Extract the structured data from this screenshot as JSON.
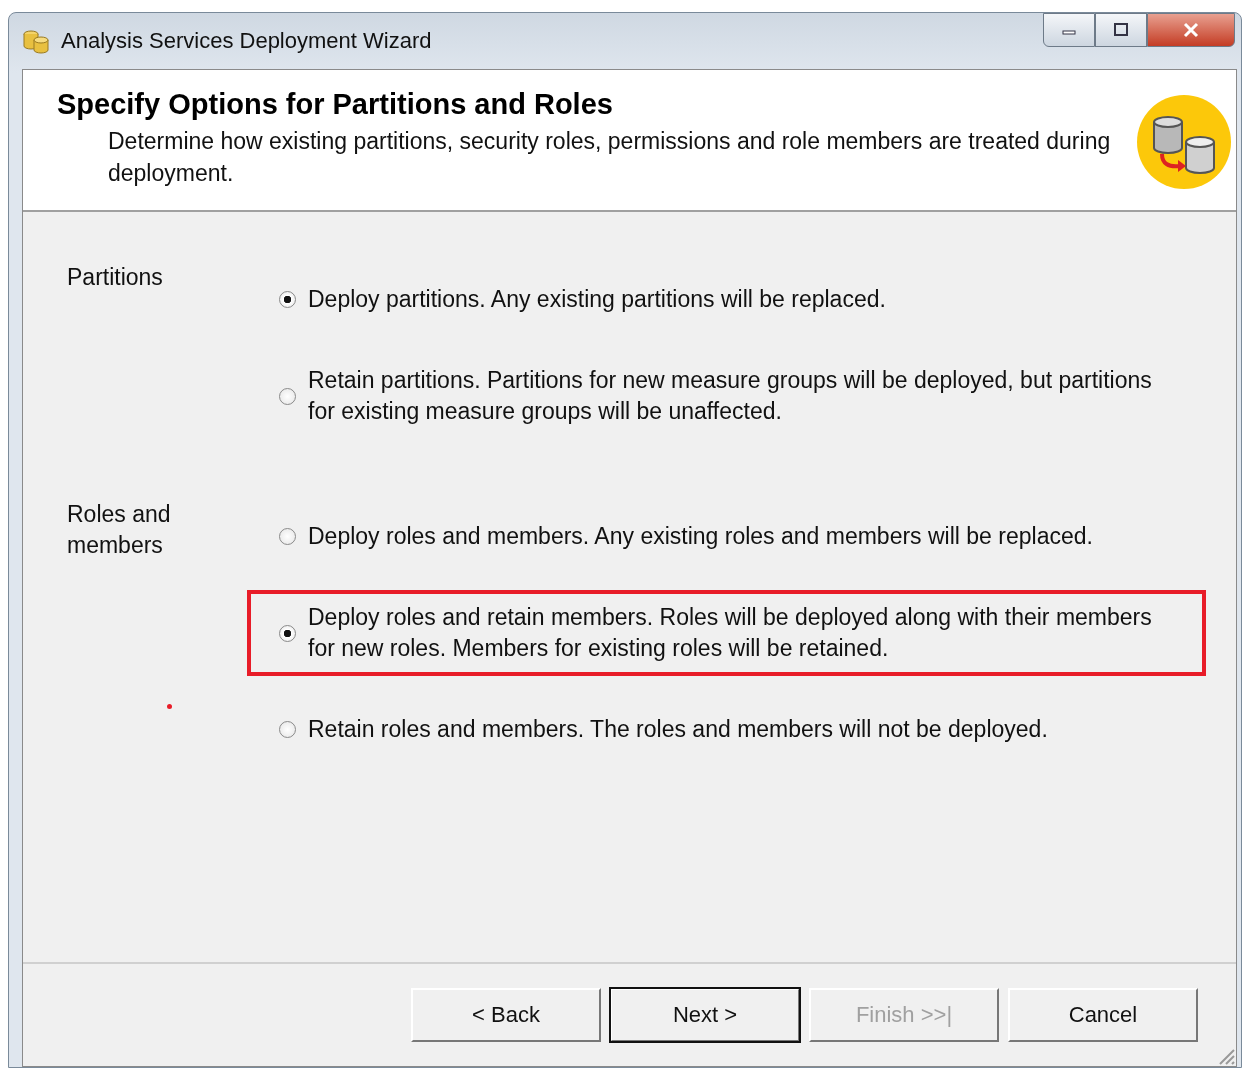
{
  "window": {
    "title": "Analysis Services Deployment Wizard"
  },
  "header": {
    "title": "Specify Options for Partitions and Roles",
    "description": "Determine how existing partitions, security roles, permissions and role members are treated during deployment."
  },
  "groups": [
    {
      "label": "Partitions",
      "options": [
        {
          "text": "Deploy partitions. Any existing partitions will be replaced.",
          "selected": true,
          "highlighted": false
        },
        {
          "text": "Retain partitions. Partitions for new measure groups will be deployed, but partitions for existing measure groups will be unaffected.",
          "selected": false,
          "highlighted": false
        }
      ]
    },
    {
      "label": "Roles and members",
      "options": [
        {
          "text": "Deploy roles and members. Any existing roles and members will be replaced.",
          "selected": false,
          "highlighted": false
        },
        {
          "text": "Deploy roles and retain members. Roles will be deployed along with their members for new roles. Members for existing roles will be retained.",
          "selected": true,
          "highlighted": true
        },
        {
          "text": "Retain roles and members. The roles and members will not be deployed.",
          "selected": false,
          "highlighted": false
        }
      ]
    }
  ],
  "buttons": [
    {
      "label": "< Back",
      "disabled": false,
      "default": false
    },
    {
      "label": "Next >",
      "disabled": false,
      "default": true
    },
    {
      "label": "Finish >>|",
      "disabled": true,
      "default": false
    },
    {
      "label": "Cancel",
      "disabled": false,
      "default": false
    }
  ]
}
